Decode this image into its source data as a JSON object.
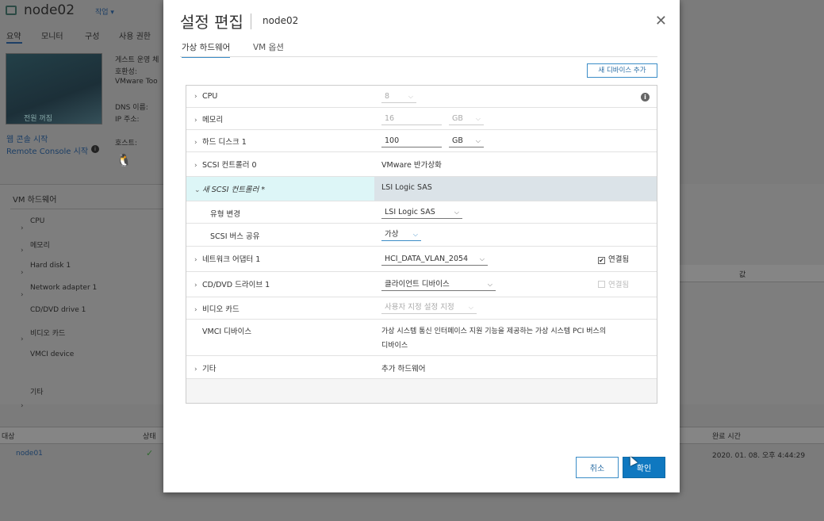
{
  "background": {
    "vm_name": "node02",
    "actions_menu": "작업 ▾",
    "tabs": [
      "요약",
      "모니터",
      "구성",
      "사용 권한"
    ],
    "console_overlay": "전원 꺼짐",
    "info_labels": [
      "게스트 운영 체",
      "호환성:",
      "VMware Too",
      "DNS 이름:",
      "IP 주소:",
      "호스트:"
    ],
    "web_console_link": "웹 콘솔 시작",
    "remote_console_link": "Remote Console 시작",
    "hw_panel_title": "VM 하드웨어",
    "hw_items": [
      "CPU",
      "메모리",
      "Hard disk 1",
      "Network adapter 1",
      "CD/DVD drive 1",
      "비디오 카드",
      "VMCI device",
      "기타"
    ],
    "right_col_header": "값",
    "tasks_headers": [
      "대상",
      "상태",
      "완료 시간"
    ],
    "task_target": "node01",
    "task_time": "2020. 01. 08. 오후 4:44:29"
  },
  "dialog": {
    "title": "설정 편집",
    "subtitle": "node02",
    "tabs": [
      "가상 하드웨어",
      "VM 옵션"
    ],
    "add_device": "새 디바이스 추가",
    "rows": {
      "cpu": {
        "label": "CPU",
        "value": "8"
      },
      "memory": {
        "label": "메모리",
        "value": "16",
        "unit": "GB"
      },
      "disk": {
        "label": "하드 디스크 1",
        "value": "100",
        "unit": "GB"
      },
      "scsi0": {
        "label": "SCSI 컨트롤러 0",
        "value": "VMware 반가상화"
      },
      "new_scsi": {
        "label": "새 SCSI 컨트롤러 *",
        "value": "LSI Logic SAS"
      },
      "type_change": {
        "label": "유형 변경",
        "value": "LSI Logic SAS"
      },
      "bus_sharing": {
        "label": "SCSI 버스 공유",
        "value": "가상"
      },
      "nic": {
        "label": "네트워크 어댑터 1",
        "value": "HCI_DATA_VLAN_2054",
        "check": "연결됨"
      },
      "cdrom": {
        "label": "CD/DVD 드라이브 1",
        "value": "클라이언트 디바이스",
        "check": "연결됨"
      },
      "video": {
        "label": "비디오 카드",
        "value": "사용자 지정 설정 지정"
      },
      "vmci": {
        "label": "VMCI 디바이스",
        "value_line1": "가상 시스템 통신 인터페이스 지원 기능을 제공하는 가상 시스템 PCI 버스의",
        "value_line2": "디바이스"
      },
      "other": {
        "label": "기타",
        "value": "추가 하드웨어"
      }
    },
    "cancel": "취소",
    "ok": "확인"
  },
  "colors": {
    "accent": "#0f78c0",
    "highlight_row": "#ddf6f7",
    "selected_value_bg": "#dbe3e8"
  }
}
